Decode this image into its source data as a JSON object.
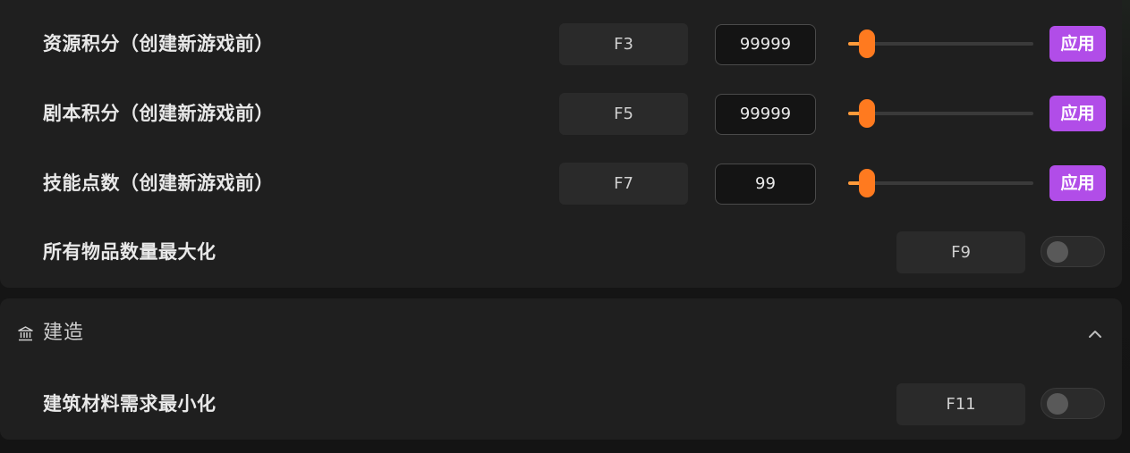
{
  "options": [
    {
      "label": "资源积分（创建新游戏前）",
      "hotkey": "F3",
      "value": "99999",
      "slider_fraction": 0.1,
      "apply_label": "应用"
    },
    {
      "label": "剧本积分（创建新游戏前）",
      "hotkey": "F5",
      "value": "99999",
      "slider_fraction": 0.1,
      "apply_label": "应用"
    },
    {
      "label": "技能点数（创建新游戏前）",
      "hotkey": "F7",
      "value": "99",
      "slider_fraction": 0.1,
      "apply_label": "应用"
    },
    {
      "label": "所有物品数量最大化",
      "hotkey": "F9",
      "toggle_on": false
    }
  ],
  "build_section": {
    "title": "建造",
    "icon": "building-icon",
    "collapse_icon": "chevron-up-icon",
    "options": [
      {
        "label": "建筑材料需求最小化",
        "hotkey": "F11",
        "toggle_on": false
      }
    ]
  },
  "colors": {
    "accent_purple": "#b14de8",
    "slider_orange": "#ff7a1f",
    "card_bg": "#1f1f1f",
    "page_bg": "#141414"
  }
}
